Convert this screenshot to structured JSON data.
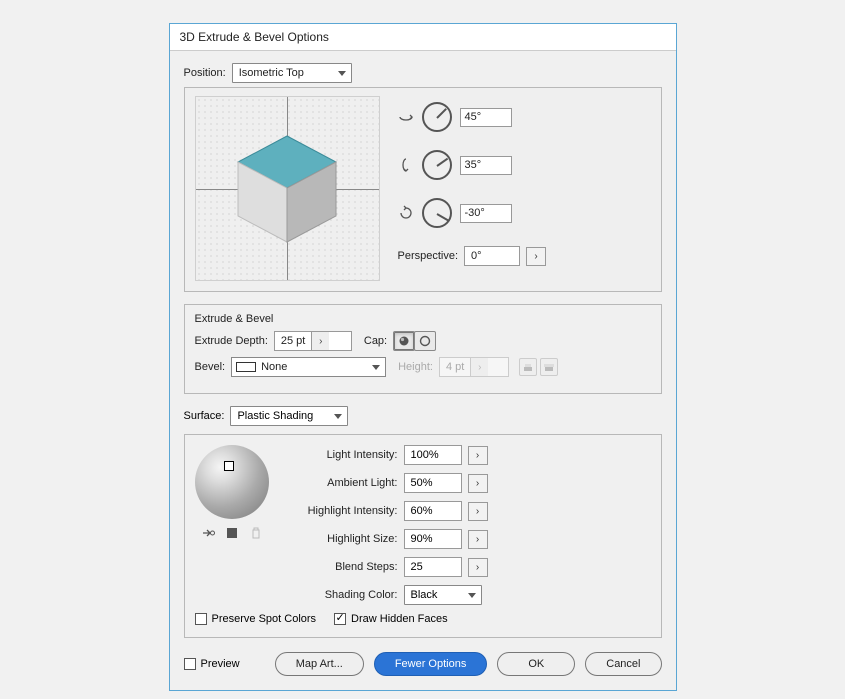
{
  "title": "3D Extrude & Bevel Options",
  "position": {
    "label": "Position:",
    "value": "Isometric Top",
    "rot_x": "45°",
    "rot_y": "35°",
    "rot_z": "-30°",
    "perspective_label": "Perspective:",
    "perspective_value": "0°"
  },
  "extrude": {
    "section_title": "Extrude & Bevel",
    "depth_label": "Extrude Depth:",
    "depth_value": "25 pt",
    "cap_label": "Cap:",
    "bevel_label": "Bevel:",
    "bevel_value": "None",
    "height_label": "Height:",
    "height_value": "4 pt"
  },
  "surface": {
    "label": "Surface:",
    "value": "Plastic Shading",
    "light_intensity_label": "Light Intensity:",
    "light_intensity_value": "100%",
    "ambient_label": "Ambient Light:",
    "ambient_value": "50%",
    "highlight_intensity_label": "Highlight Intensity:",
    "highlight_intensity_value": "60%",
    "highlight_size_label": "Highlight Size:",
    "highlight_size_value": "90%",
    "blend_steps_label": "Blend Steps:",
    "blend_steps_value": "25",
    "shading_color_label": "Shading Color:",
    "shading_color_value": "Black",
    "preserve_spot_label": "Preserve Spot Colors",
    "draw_hidden_label": "Draw Hidden Faces",
    "draw_hidden_checked": true
  },
  "footer": {
    "preview_label": "Preview",
    "map_art": "Map Art...",
    "fewer_options": "Fewer Options",
    "ok": "OK",
    "cancel": "Cancel"
  }
}
